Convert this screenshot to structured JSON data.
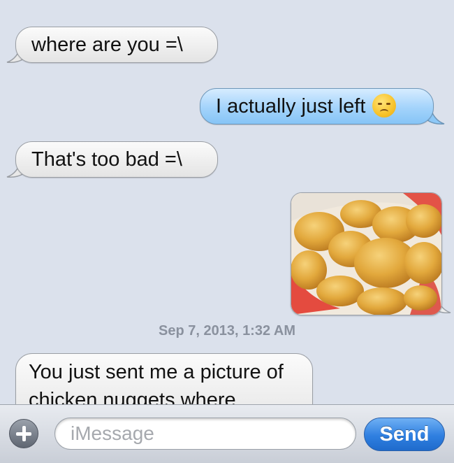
{
  "thread": {
    "messages": [
      {
        "id": "m1",
        "direction": "received",
        "text": "where are you =\\"
      },
      {
        "id": "m2",
        "direction": "sent",
        "text": "I actually just left",
        "emoji": "disappointed-face-emoji"
      },
      {
        "id": "m3",
        "direction": "received",
        "text": "That's too bad =\\"
      },
      {
        "id": "m4",
        "direction": "sent",
        "type": "image",
        "image": "chicken-nuggets-photo"
      },
      {
        "id": "m5",
        "direction": "received",
        "text": "You just sent me a picture of chicken nuggets where"
      }
    ],
    "timestamp": "Sep 7, 2013, 1:32 AM"
  },
  "composer": {
    "placeholder": "iMessage",
    "send_label": "Send",
    "attach_icon": "plus-icon"
  },
  "colors": {
    "background": "#dbe1ec",
    "sent_bubble": "#a3d3fb",
    "received_bubble": "#f0f0f0",
    "send_button": "#2f7fe0"
  }
}
